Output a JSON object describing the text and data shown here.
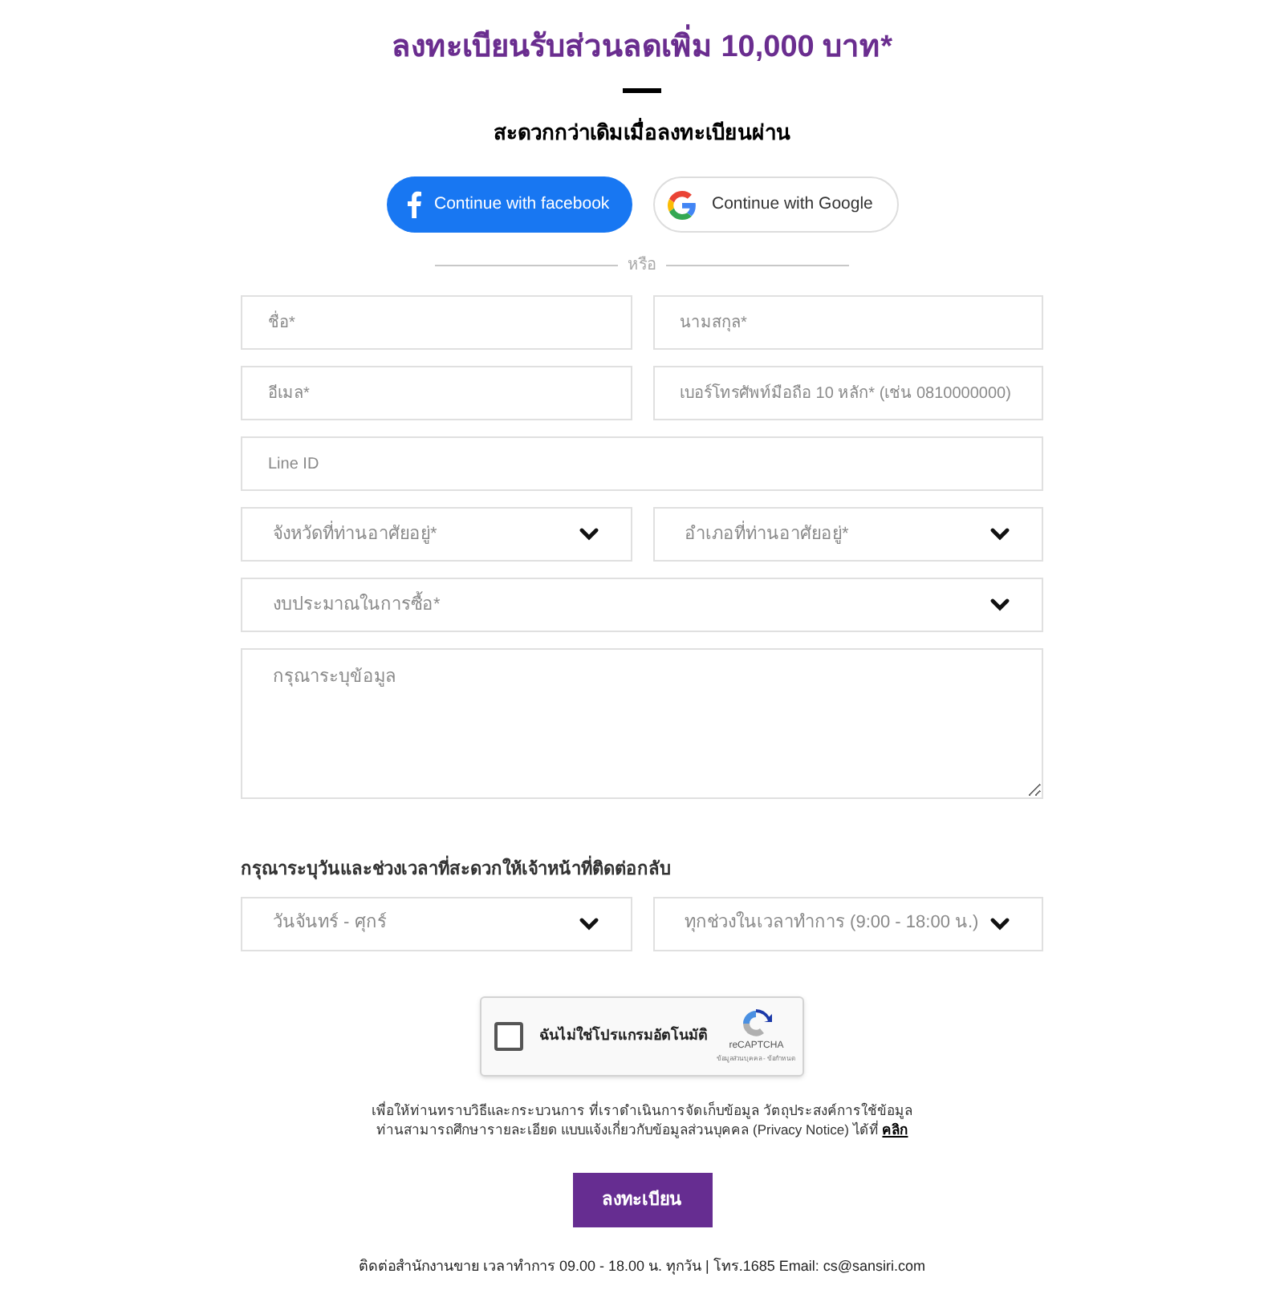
{
  "title": "ลงทะเบียนรับส่วนลดเพิ่ม 10,000 บาท*",
  "subtitle": "สะดวกกว่าเดิมเมื่อลงทะเบียนผ่าน",
  "social_buttons": [
    {
      "kind": "facebook",
      "label": "Continue with facebook"
    },
    {
      "kind": "google",
      "label": "Continue with Google"
    }
  ],
  "divider_label": "หรือ",
  "form_rows": [
    [
      {
        "kind": "text",
        "placeholder": "ชื่อ*"
      },
      {
        "kind": "text",
        "placeholder": "นามสกุล*"
      }
    ],
    [
      {
        "kind": "text",
        "placeholder": "อีเมล*"
      },
      {
        "kind": "text",
        "placeholder": "เบอร์โทรศัพท์มือถือ 10 หลัก* (เช่น 0810000000)"
      }
    ],
    [
      {
        "kind": "text",
        "placeholder": "Line ID"
      }
    ],
    [
      {
        "kind": "select",
        "placeholder": "จังหวัดที่ท่านอาศัยอยู่*"
      },
      {
        "kind": "select",
        "placeholder": "อำเภอที่ท่านอาศัยอยู่*"
      }
    ],
    [
      {
        "kind": "select",
        "placeholder": "งบประมาณในการซื้อ*"
      }
    ],
    [
      {
        "kind": "textarea",
        "placeholder": "กรุณาระบุข้อมูล"
      }
    ]
  ],
  "callback": {
    "label": "กรุณาระบุวันและช่วงเวลาที่สะดวกให้เจ้าหน้าที่ติดต่อกลับ",
    "selects": [
      {
        "value": "วันจันทร์ - ศุกร์"
      },
      {
        "value": "ทุกช่วงในเวลาทำการ (9:00 - 18:00 น.)"
      }
    ]
  },
  "captcha": {
    "label": "ฉันไม่ใช่โปรแกรมอัตโนมัติ",
    "checked": false,
    "brand": "reCAPTCHA",
    "links": "ข้อมูลส่วนบุคคล - ข้อกำหนด"
  },
  "notice": {
    "line_1": "เพื่อให้ท่านทราบวิธีและกระบวนการ ที่เราดำเนินการจัดเก็บข้อมูล วัตถุประสงค์การใช้ข้อมูล",
    "line_2": "ท่านสามารถศึกษารายละเอียด แบบแจ้งเกี่ยวกับข้อมูลส่วนบุคคล (Privacy Notice) ได้ที่",
    "link": "คลิก"
  },
  "submit": "ลงทะเบียน",
  "footer": "ติดต่อสำนักงานขาย เวลาทำการ 09.00 - 18.00 น. ทุกวัน | โทร.1685 Email: cs@sansiri.com"
}
